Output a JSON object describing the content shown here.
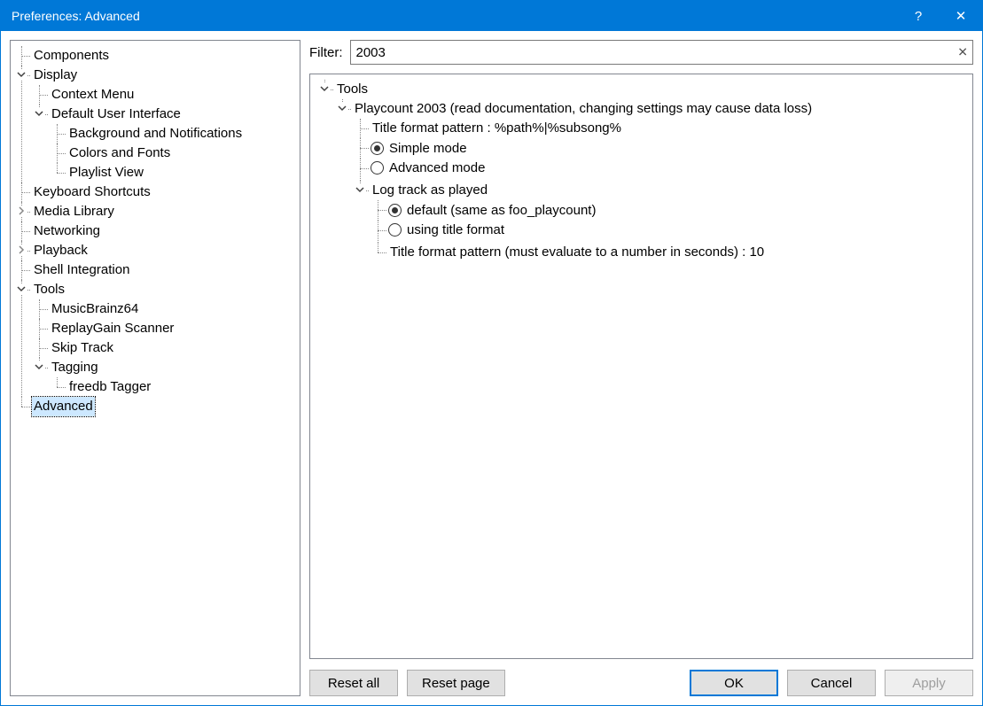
{
  "window": {
    "title": "Preferences: Advanced",
    "help_glyph": "?",
    "close_glyph": "✕"
  },
  "left_tree": {
    "components": "Components",
    "display": "Display",
    "context_menu": "Context Menu",
    "dui": "Default User Interface",
    "bg_notif": "Background and Notifications",
    "colors_fonts": "Colors and Fonts",
    "playlist_view": "Playlist View",
    "kbd": "Keyboard Shortcuts",
    "media_lib": "Media Library",
    "networking": "Networking",
    "playback": "Playback",
    "shell": "Shell Integration",
    "tools": "Tools",
    "musicbrainz": "MusicBrainz64",
    "rg_scanner": "ReplayGain Scanner",
    "skip_track": "Skip Track",
    "tagging": "Tagging",
    "freedb": "freedb Tagger",
    "advanced": "Advanced"
  },
  "filter": {
    "label": "Filter:",
    "value": "2003",
    "clear_glyph": "✕"
  },
  "right_tree": {
    "tools": "Tools",
    "playcount": "Playcount 2003 (read documentation, changing settings may cause data loss)",
    "tf_pattern": "Title format pattern : %path%|%subsong%",
    "simple_mode": "Simple mode",
    "advanced_mode": "Advanced mode",
    "log_track": "Log track as played",
    "default_same": "default (same as foo_playcount)",
    "using_tf": "using title format",
    "tf_seconds": "Title format pattern (must evaluate to a number in seconds) : 10"
  },
  "buttons": {
    "reset_all": "Reset all",
    "reset_page": "Reset page",
    "ok": "OK",
    "cancel": "Cancel",
    "apply": "Apply"
  }
}
